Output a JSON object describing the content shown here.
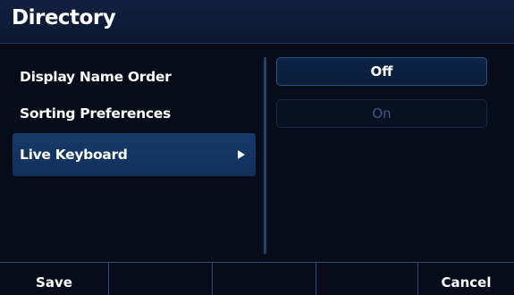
{
  "header": {
    "title": "Directory"
  },
  "menu": {
    "items": [
      {
        "label": "Display Name Order"
      },
      {
        "label": "Sorting Preferences"
      },
      {
        "label": "Live Keyboard"
      }
    ]
  },
  "options": {
    "items": [
      {
        "label": "Off",
        "state": "selected"
      },
      {
        "label": "On",
        "state": "unselected"
      }
    ]
  },
  "softkeys": [
    {
      "label": "Save"
    },
    {
      "label": ""
    },
    {
      "label": ""
    },
    {
      "label": ""
    },
    {
      "label": "Cancel"
    }
  ],
  "colors": {
    "background": "#060c1a",
    "selected_item": "#163a6a",
    "divider": "#1e4272",
    "disabled_text": "#3d5a82"
  },
  "icons": {
    "submenu_arrow": "triangle-right-icon"
  }
}
